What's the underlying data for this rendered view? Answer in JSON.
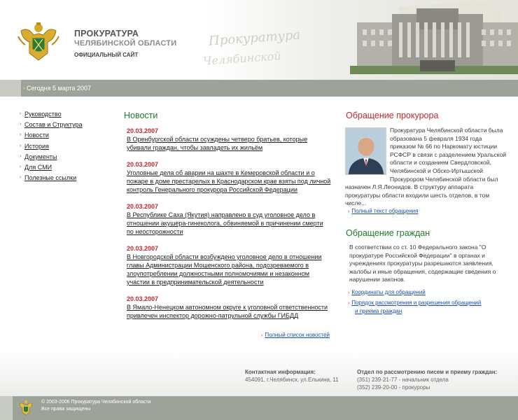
{
  "header": {
    "title": "ПРОКУРАТУРА",
    "subtitle": "ЧЕЛЯБИНСКОЙ ОБЛАСТИ",
    "official": "ОФИЦИАЛЬНЫЙ САЙТ",
    "script_line1": "Прокуратура",
    "script_line2": "Челябинской"
  },
  "datebar": {
    "date": "Сегодня 5 марта 2007"
  },
  "nav": {
    "items": [
      {
        "label": "Руководство"
      },
      {
        "label": "Состав и Структура"
      },
      {
        "label": "Новости"
      },
      {
        "label": "История"
      },
      {
        "label": "Документы"
      },
      {
        "label": "Для СМИ"
      },
      {
        "label": "Полезные ссылки"
      }
    ]
  },
  "news": {
    "heading": "Новости",
    "items": [
      {
        "date": "20.03.2007",
        "text": "В Оренбургской области осуждены четверо братьев, которые убивали граждан, чтобы завладеть их жильём"
      },
      {
        "date": "20.03.2007",
        "text": "Уголовные дела об аварии на шахте в Кемеровской области и о пожаре в доме престарелых в Краснодарском крае взяты под личной контроль Генерального прокурора Российской Федерации"
      },
      {
        "date": "20.03.2007",
        "text": "В Республике Саха (Якутия) направлено в суд уголовное дело в отношении акушера-гинеколога, обвиняемой в причинении смерти по неосторожности"
      },
      {
        "date": "20.03.2007",
        "text": "В Новгородской области возбуждено уголовное дело в отношении главы Администрации Мошенского района, подозреваемого в злоупотреблении должностными полномочиями и незаконном участии в предпринимательской деятельности"
      },
      {
        "date": "20.03.2007",
        "text": "В Ямало-Ненецком автономном округе к уголовной ответственности привлечен инспектор дорожно-патрульной службы ГИБДД"
      }
    ],
    "all_link": "Полный список новостей"
  },
  "appeal": {
    "heading": "Обращение прокурора",
    "text": "Прокуратура Челябинской области была образована 5 февраля 1934 года приказом № 66 по Наркомату юстиции РСФСР в связи с разделением Уральской области и созданием Свердловской, Челябинской и Обско-Иртышской Прокурором Челябинской области был назначен Л.Я.Леонидов. В структуру аппарата прокуратуры области входили шесть отделов, в том числе...",
    "link": "Полный текст обращения"
  },
  "citizen": {
    "heading": "Обращение граждан",
    "text": "В соответствии со ст. 10 Федерального закона \"О прокуратуре Российской Федерации\" в органах и учреждениях прокуратуры разрешаются заявления, жалобы и иные обращения, содержащие сведения о нарушении законов.",
    "link1": "Координаты для обращений",
    "link2_line1": "Порядок рассмотрения и разрешения обращений",
    "link2_line2": "и приема граждан"
  },
  "contacts": {
    "title1": "Контактная информация:",
    "address": "454091, г.Челябинск, ул.Елькина, 11",
    "title2": "Отдел по рассмотрению писем и приему граждан:",
    "phone1": "(351) 239-21-77 - начальник отдела",
    "phone2": "(352) 239-20-00 - прокуроры"
  },
  "footer": {
    "copyright": "© 2003-2006 Прокуратура Челябинской области",
    "rights": "Все права защищены"
  },
  "colors": {
    "accent_red": "#c0282c",
    "heading_green": "#1f7a2a",
    "bar_gray": "#9ea39a",
    "link_blue": "#1a4ea8"
  },
  "icons": {
    "emblem": "prosecutor-emblem-icon",
    "arrow": "arrow-right-icon",
    "building": "building-image"
  }
}
